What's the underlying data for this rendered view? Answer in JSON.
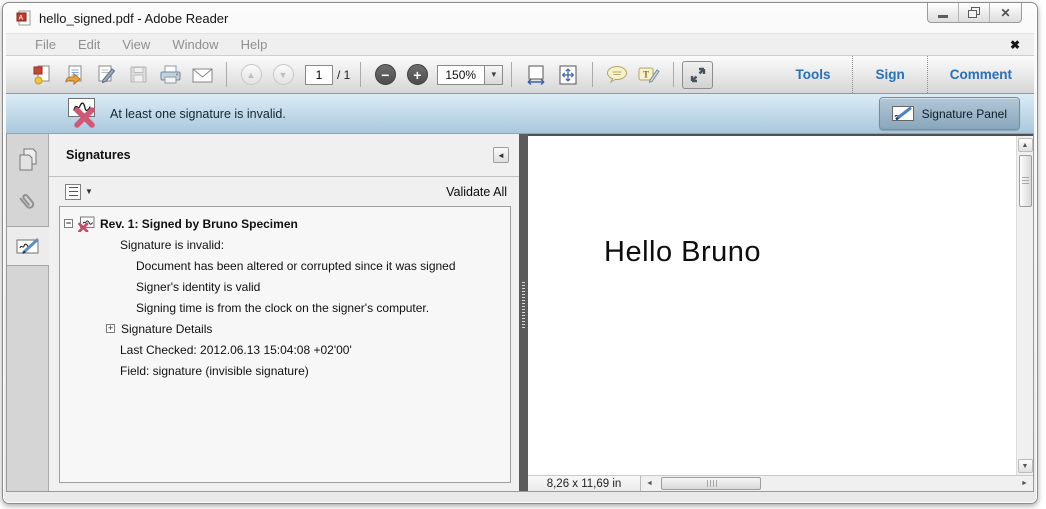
{
  "window": {
    "title": "hello_signed.pdf - Adobe Reader"
  },
  "menu": {
    "items": [
      "File",
      "Edit",
      "View",
      "Window",
      "Help"
    ]
  },
  "toolbar": {
    "page_current": "1",
    "page_total": "/ 1",
    "zoom": "150%",
    "tools": "Tools",
    "sign": "Sign",
    "comment": "Comment"
  },
  "message_bar": {
    "text": "At least one signature is invalid.",
    "panel_button": "Signature Panel"
  },
  "panel": {
    "title": "Signatures",
    "validate_all": "Validate All",
    "tree": {
      "root": "Rev. 1: Signed by Bruno Specimen",
      "items": [
        "Signature is invalid:",
        "Document has been altered or corrupted since it was signed",
        "Signer's identity is valid",
        "Signing time is from the clock on the signer's computer.",
        "Signature Details",
        "Last Checked: 2012.06.13 15:04:08 +02'00'",
        "Field: signature (invisible signature)"
      ]
    }
  },
  "document": {
    "text": "Hello Bruno",
    "size": "8,26 x 11,69 in"
  },
  "icons": {
    "close_x": "✕",
    "menubar_close": "✖",
    "dropdown": "▼",
    "panel_collapse": "◄",
    "collapse_box": "−",
    "expand_box": "+",
    "minus": "−",
    "plus": "+",
    "up": "▲",
    "down": "▼",
    "left": "◄",
    "right": "►"
  },
  "colors": {
    "accent_blue": "#2970b8",
    "invalid_red": "#cf5876",
    "infobar_top": "#dcecf7",
    "infobar_bottom": "#a9c8dd",
    "splitter": "#5b5b5b"
  }
}
